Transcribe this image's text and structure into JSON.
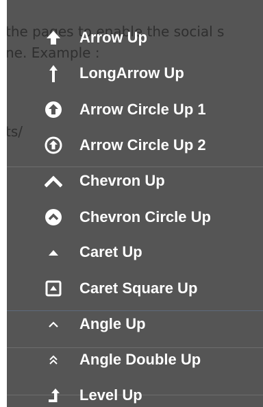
{
  "background": {
    "lines": [
      "the pages to enable the social s",
      "ne. Example :",
      "ts/"
    ]
  },
  "menu": {
    "items": [
      {
        "label": "Arrow Up",
        "icon": "arrow-up-icon"
      },
      {
        "label": "LongArrow Up",
        "icon": "long-arrow-up-icon"
      },
      {
        "label": "Arrow Circle Up 1",
        "icon": "arrow-circle-up-icon"
      },
      {
        "label": "Arrow Circle Up 2",
        "icon": "arrow-circle-up-outline-icon"
      },
      {
        "label": "Chevron Up",
        "icon": "chevron-up-icon"
      },
      {
        "label": "Chevron Circle Up",
        "icon": "chevron-circle-up-icon"
      },
      {
        "label": "Caret Up",
        "icon": "caret-up-icon"
      },
      {
        "label": "Caret Square Up",
        "icon": "caret-square-up-icon"
      },
      {
        "label": "Angle Up",
        "icon": "angle-up-icon"
      },
      {
        "label": "Angle Double Up",
        "icon": "angle-double-up-icon"
      },
      {
        "label": "Level Up",
        "icon": "level-up-icon"
      }
    ]
  }
}
